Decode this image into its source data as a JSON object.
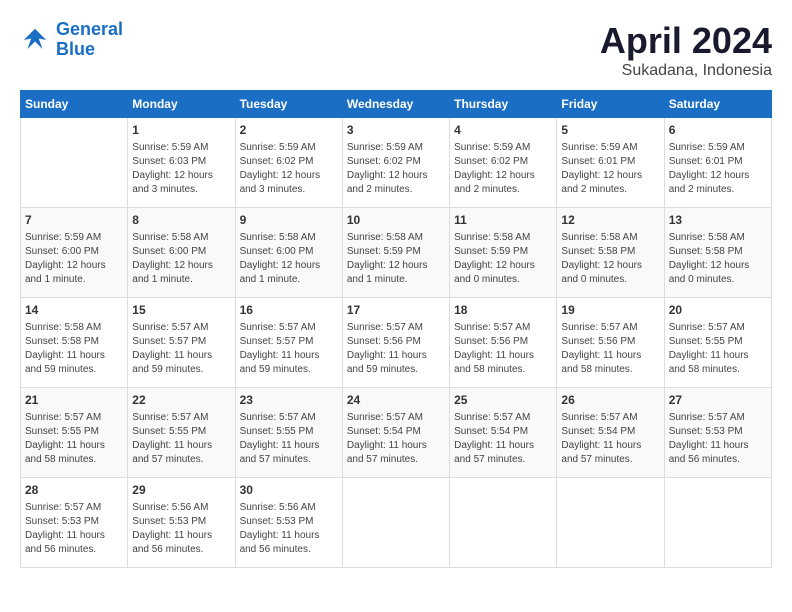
{
  "logo": {
    "line1": "General",
    "line2": "Blue"
  },
  "title": "April 2024",
  "location": "Sukadana, Indonesia",
  "weekdays": [
    "Sunday",
    "Monday",
    "Tuesday",
    "Wednesday",
    "Thursday",
    "Friday",
    "Saturday"
  ],
  "weeks": [
    [
      {
        "day": "",
        "detail": ""
      },
      {
        "day": "1",
        "detail": "Sunrise: 5:59 AM\nSunset: 6:03 PM\nDaylight: 12 hours\nand 3 minutes."
      },
      {
        "day": "2",
        "detail": "Sunrise: 5:59 AM\nSunset: 6:02 PM\nDaylight: 12 hours\nand 3 minutes."
      },
      {
        "day": "3",
        "detail": "Sunrise: 5:59 AM\nSunset: 6:02 PM\nDaylight: 12 hours\nand 2 minutes."
      },
      {
        "day": "4",
        "detail": "Sunrise: 5:59 AM\nSunset: 6:02 PM\nDaylight: 12 hours\nand 2 minutes."
      },
      {
        "day": "5",
        "detail": "Sunrise: 5:59 AM\nSunset: 6:01 PM\nDaylight: 12 hours\nand 2 minutes."
      },
      {
        "day": "6",
        "detail": "Sunrise: 5:59 AM\nSunset: 6:01 PM\nDaylight: 12 hours\nand 2 minutes."
      }
    ],
    [
      {
        "day": "7",
        "detail": "Sunrise: 5:59 AM\nSunset: 6:00 PM\nDaylight: 12 hours\nand 1 minute."
      },
      {
        "day": "8",
        "detail": "Sunrise: 5:58 AM\nSunset: 6:00 PM\nDaylight: 12 hours\nand 1 minute."
      },
      {
        "day": "9",
        "detail": "Sunrise: 5:58 AM\nSunset: 6:00 PM\nDaylight: 12 hours\nand 1 minute."
      },
      {
        "day": "10",
        "detail": "Sunrise: 5:58 AM\nSunset: 5:59 PM\nDaylight: 12 hours\nand 1 minute."
      },
      {
        "day": "11",
        "detail": "Sunrise: 5:58 AM\nSunset: 5:59 PM\nDaylight: 12 hours\nand 0 minutes."
      },
      {
        "day": "12",
        "detail": "Sunrise: 5:58 AM\nSunset: 5:58 PM\nDaylight: 12 hours\nand 0 minutes."
      },
      {
        "day": "13",
        "detail": "Sunrise: 5:58 AM\nSunset: 5:58 PM\nDaylight: 12 hours\nand 0 minutes."
      }
    ],
    [
      {
        "day": "14",
        "detail": "Sunrise: 5:58 AM\nSunset: 5:58 PM\nDaylight: 11 hours\nand 59 minutes."
      },
      {
        "day": "15",
        "detail": "Sunrise: 5:57 AM\nSunset: 5:57 PM\nDaylight: 11 hours\nand 59 minutes."
      },
      {
        "day": "16",
        "detail": "Sunrise: 5:57 AM\nSunset: 5:57 PM\nDaylight: 11 hours\nand 59 minutes."
      },
      {
        "day": "17",
        "detail": "Sunrise: 5:57 AM\nSunset: 5:56 PM\nDaylight: 11 hours\nand 59 minutes."
      },
      {
        "day": "18",
        "detail": "Sunrise: 5:57 AM\nSunset: 5:56 PM\nDaylight: 11 hours\nand 58 minutes."
      },
      {
        "day": "19",
        "detail": "Sunrise: 5:57 AM\nSunset: 5:56 PM\nDaylight: 11 hours\nand 58 minutes."
      },
      {
        "day": "20",
        "detail": "Sunrise: 5:57 AM\nSunset: 5:55 PM\nDaylight: 11 hours\nand 58 minutes."
      }
    ],
    [
      {
        "day": "21",
        "detail": "Sunrise: 5:57 AM\nSunset: 5:55 PM\nDaylight: 11 hours\nand 58 minutes."
      },
      {
        "day": "22",
        "detail": "Sunrise: 5:57 AM\nSunset: 5:55 PM\nDaylight: 11 hours\nand 57 minutes."
      },
      {
        "day": "23",
        "detail": "Sunrise: 5:57 AM\nSunset: 5:55 PM\nDaylight: 11 hours\nand 57 minutes."
      },
      {
        "day": "24",
        "detail": "Sunrise: 5:57 AM\nSunset: 5:54 PM\nDaylight: 11 hours\nand 57 minutes."
      },
      {
        "day": "25",
        "detail": "Sunrise: 5:57 AM\nSunset: 5:54 PM\nDaylight: 11 hours\nand 57 minutes."
      },
      {
        "day": "26",
        "detail": "Sunrise: 5:57 AM\nSunset: 5:54 PM\nDaylight: 11 hours\nand 57 minutes."
      },
      {
        "day": "27",
        "detail": "Sunrise: 5:57 AM\nSunset: 5:53 PM\nDaylight: 11 hours\nand 56 minutes."
      }
    ],
    [
      {
        "day": "28",
        "detail": "Sunrise: 5:57 AM\nSunset: 5:53 PM\nDaylight: 11 hours\nand 56 minutes."
      },
      {
        "day": "29",
        "detail": "Sunrise: 5:56 AM\nSunset: 5:53 PM\nDaylight: 11 hours\nand 56 minutes."
      },
      {
        "day": "30",
        "detail": "Sunrise: 5:56 AM\nSunset: 5:53 PM\nDaylight: 11 hours\nand 56 minutes."
      },
      {
        "day": "",
        "detail": ""
      },
      {
        "day": "",
        "detail": ""
      },
      {
        "day": "",
        "detail": ""
      },
      {
        "day": "",
        "detail": ""
      }
    ]
  ]
}
